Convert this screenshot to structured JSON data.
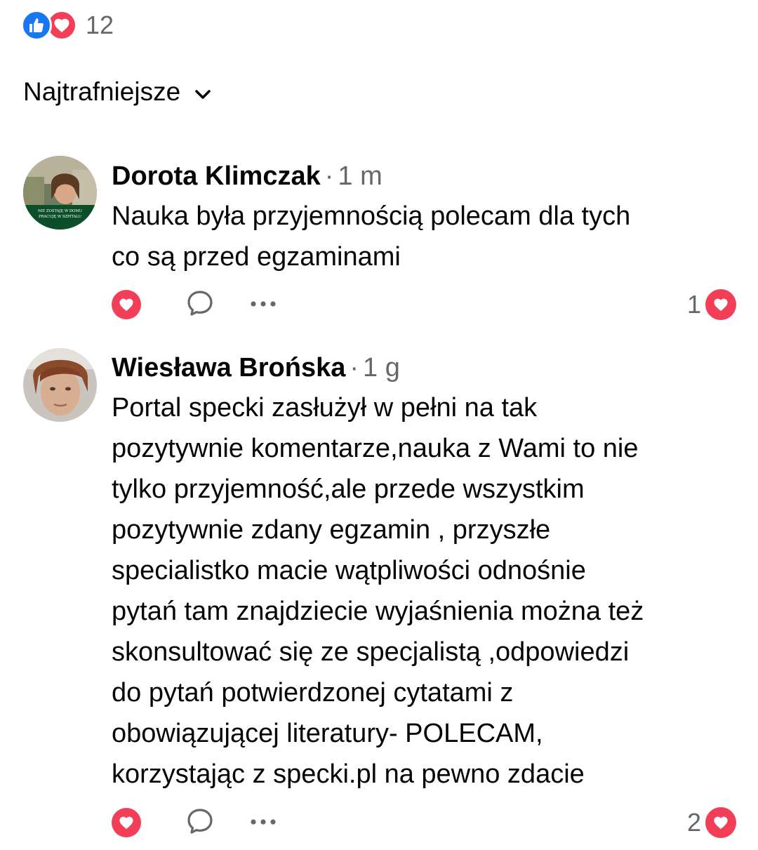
{
  "reactions": {
    "count": "12",
    "icons": [
      "like-icon",
      "love-icon"
    ],
    "colors": {
      "like": "#1877f2",
      "love": "#f33e58"
    }
  },
  "sort": {
    "label": "Najtrafniejsze",
    "icon": "chevron-down-icon"
  },
  "comments": [
    {
      "author": "Dorota Klimczak",
      "separator": "·",
      "time": "1 m",
      "text": "Nauka była przyjemnością polecam  dla tych\nco są przed egzaminami",
      "avatar_badge_line1": "NIE ZOSTAJĘ W DOMU",
      "avatar_badge_line2": "PRACUJĘ W SZPITALU",
      "reaction_count": "1",
      "actions": [
        "love-icon",
        "comment-icon",
        "more-icon"
      ]
    },
    {
      "author": "Wiesława Brońska",
      "separator": "·",
      "time": "1 g",
      "text": "Portal specki zasłużył w pełni na tak\npozytywnie komentarze,nauka z Wami to nie\ntylko przyjemność,ale przede wszystkim\npozytywnie zdany egzamin , przyszłe\nspecialistko macie wątpliwości odnośnie\npytań tam znajdziecie wyjaśnienia można też\nskonsultować się ze specjalistą ,odpowiedzi\ndo pytań potwierdzonej cytatami z\nobowiązującej literatury- POLECAM,\nkorzystając z specki.pl na pewno zdacie",
      "reaction_count": "2",
      "actions": [
        "love-icon",
        "comment-icon",
        "more-icon"
      ]
    }
  ]
}
